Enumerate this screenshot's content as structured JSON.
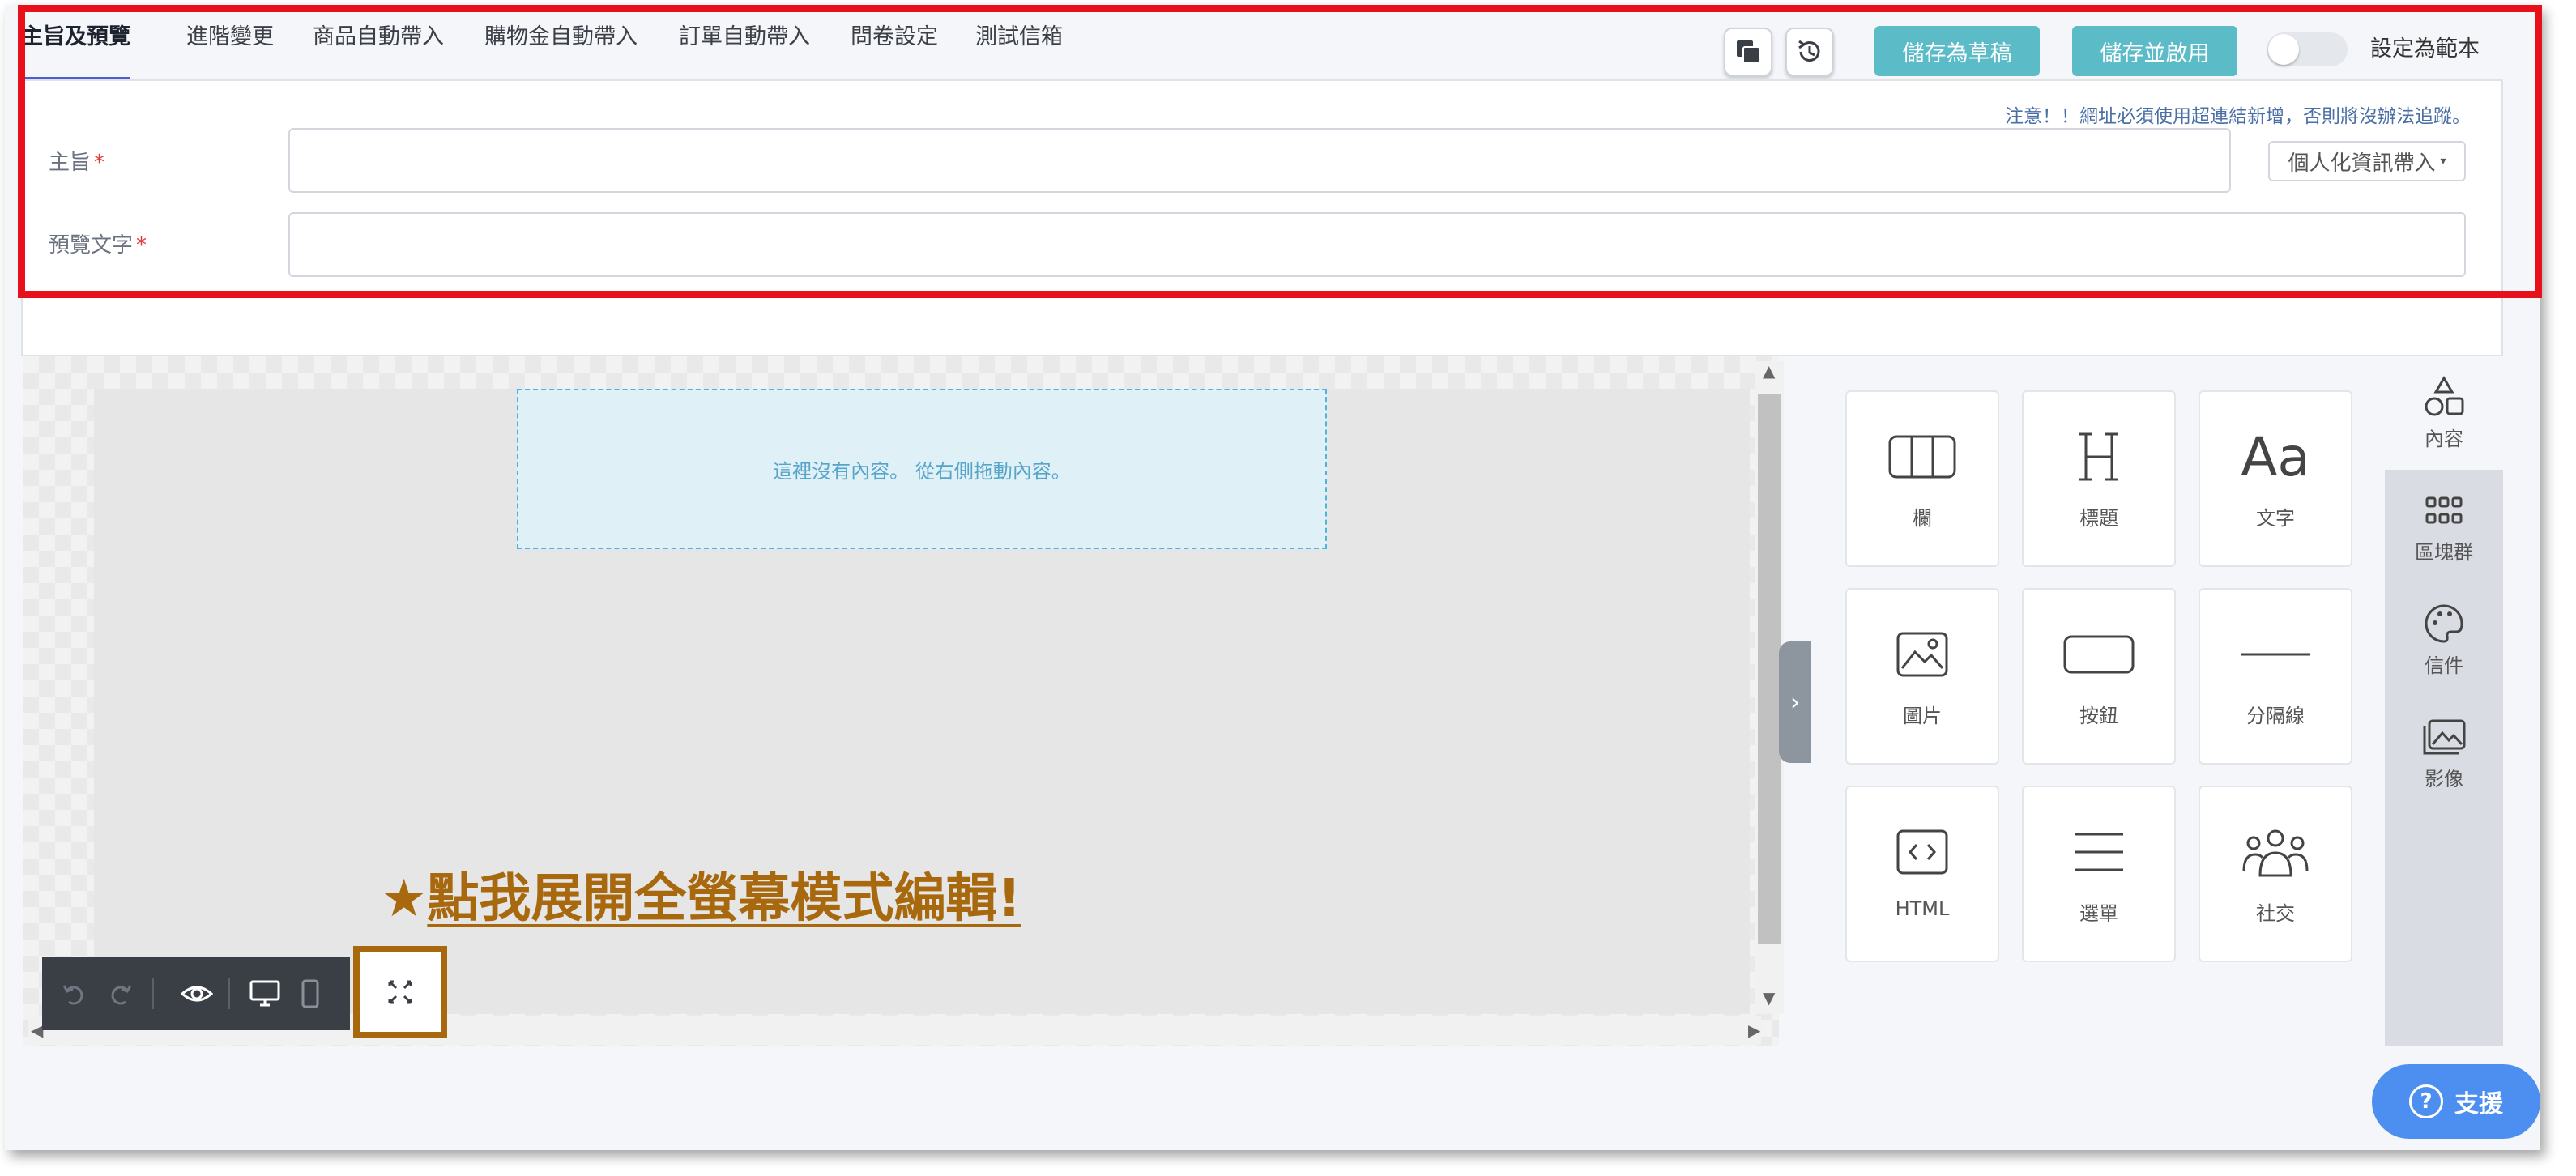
{
  "tabs": [
    {
      "label": "主旨及預覽",
      "active": true
    },
    {
      "label": "進階變更"
    },
    {
      "label": "商品自動帶入"
    },
    {
      "label": "購物金自動帶入"
    },
    {
      "label": "訂單自動帶入"
    },
    {
      "label": "問卷設定"
    },
    {
      "label": "測試信箱"
    }
  ],
  "header_actions": {
    "copy_icon": "copy-icon",
    "history_icon": "history-icon",
    "save_draft": "儲存為草稿",
    "save_enable": "儲存並啟用",
    "template_toggle_label": "設定為範本",
    "template_toggle_on": false
  },
  "form": {
    "notice": "注意！！網址必須使用超連結新增，否則將沒辦法追蹤。",
    "subject_label": "主旨",
    "subject_value": "",
    "preview_label": "預覽文字",
    "preview_value": "",
    "personalize_button": "個人化資訊帶入",
    "required_mark": "*"
  },
  "canvas": {
    "empty_hint": "這裡沒有內容。 從右側拖動內容。",
    "callout_star": "★",
    "callout_text": "點我展開全螢幕模式編輯!",
    "toolbar": [
      "undo-icon",
      "redo-icon",
      "preview-eye-icon",
      "desktop-icon",
      "mobile-icon"
    ],
    "expand_icon": "fullscreen-expand-icon"
  },
  "components": [
    {
      "label": "欄",
      "icon": "columns-icon"
    },
    {
      "label": "標題",
      "icon": "heading-icon"
    },
    {
      "label": "文字",
      "icon": "text-icon"
    },
    {
      "label": "圖片",
      "icon": "image-icon"
    },
    {
      "label": "按鈕",
      "icon": "button-icon"
    },
    {
      "label": "分隔線",
      "icon": "divider-icon"
    },
    {
      "label": "HTML",
      "icon": "html-icon"
    },
    {
      "label": "選單",
      "icon": "menu-icon"
    },
    {
      "label": "社交",
      "icon": "social-icon"
    }
  ],
  "side_tabs": [
    {
      "label": "內容",
      "icon": "shapes-icon",
      "active": true
    },
    {
      "label": "區塊群",
      "icon": "blocks-icon"
    },
    {
      "label": "信件",
      "icon": "palette-icon"
    },
    {
      "label": "影像",
      "icon": "images-icon"
    }
  ],
  "support": {
    "label": "支援",
    "icon": "question-icon"
  },
  "colors": {
    "accent_teal": "#5bbcc8",
    "highlight_red": "#e8101b",
    "callout_brown": "#a8690e",
    "support_blue": "#4d8ff0"
  }
}
